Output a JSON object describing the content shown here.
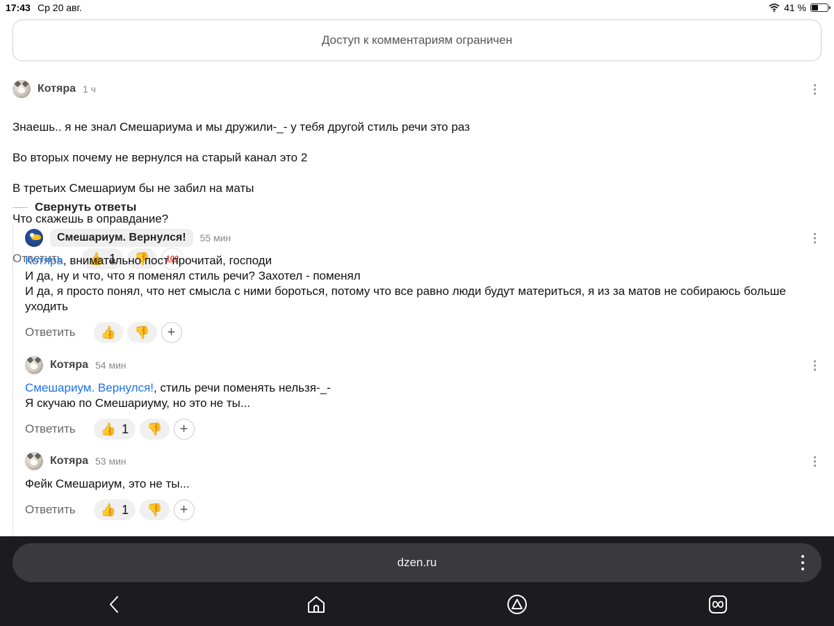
{
  "status_bar": {
    "time": "17:43",
    "date": "Ср 20 авг.",
    "battery": "41 %",
    "battery_level": 0.41
  },
  "banner": {
    "text": "Доступ к комментариям ограничен"
  },
  "comments": [
    {
      "author": "Котяра",
      "time": "1 ч",
      "lines": [
        "Знаешь.. я не знал Смешариума и мы дружили-_- у тебя другой стиль речи это раз",
        "Во вторых почему не вернулся на старый канал это 2",
        "В третьих Смешариум бы не забил на маты",
        "Что скажешь в оправдание?"
      ],
      "reply": "Ответить",
      "likes": "1",
      "extra_reaction": "100"
    },
    {
      "author": "Смешариум. Вернулся!",
      "time": "55 мин",
      "mention": "Котяра",
      "first_rest": ", внимательно пост прочитай, господи",
      "rest": "И да, ну и что, что я поменял стиль речи? Захотел - поменял\nИ да, я просто понял, что нет смысла с ними бороться, потому что все равно люди будут материться, я из за матов не собираюсь больше уходить",
      "reply": "Ответить"
    },
    {
      "author": "Котяра",
      "time": "54 мин",
      "mention": "Смешариум. Вернулся!",
      "first_rest": ", стиль речи поменять нельзя-_-",
      "rest": "Я скучаю по Смешариуму, но это не ты...",
      "reply": "Ответить",
      "likes": "1"
    },
    {
      "author": "Котяра",
      "time": "53 мин",
      "text": "Фейк Смешариум, это не ты...",
      "reply": "Ответить",
      "likes": "1"
    }
  ],
  "collapse_label": "Свернуть ответы",
  "browser": {
    "url": "dzen.ru"
  },
  "icons": [
    "wifi-icon",
    "battery-icon",
    "more-icon",
    "thumbs-up-icon",
    "thumbs-down-icon",
    "hundred-icon",
    "plus-icon",
    "back-icon",
    "home-icon",
    "alice-icon",
    "infinity-icon"
  ]
}
